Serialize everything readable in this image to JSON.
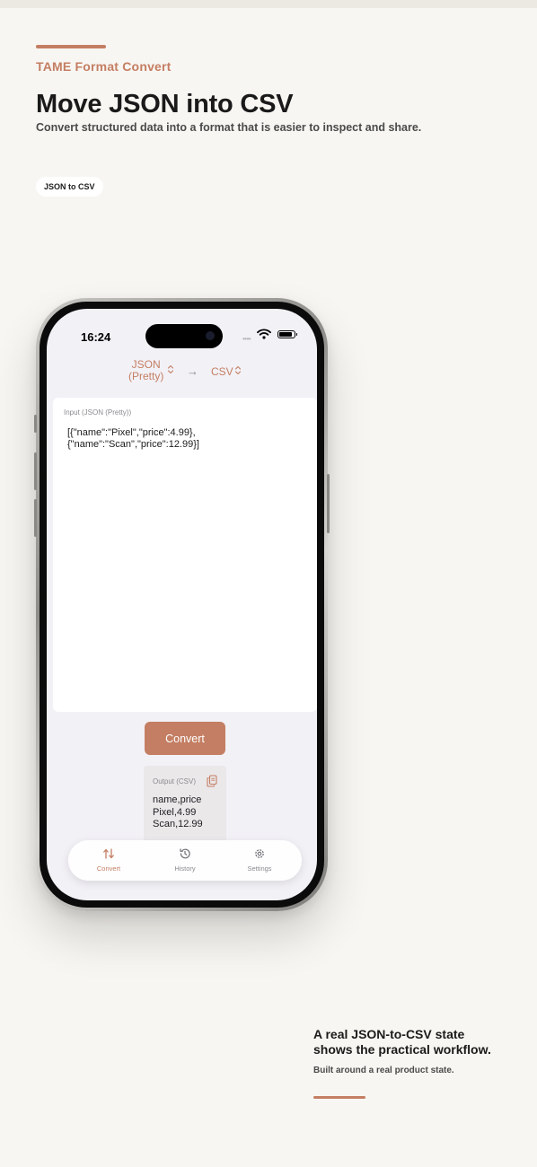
{
  "hero": {
    "brand": "TAME Format Convert",
    "headline": "Move JSON into CSV",
    "subhead": "Convert structured data into a format that is easier to inspect and share.",
    "pill": "JSON to CSV"
  },
  "device": {
    "status_time": "16:24",
    "signal_dots": "••••"
  },
  "app": {
    "from_format_line1": "JSON",
    "from_format_line2": "(Pretty)",
    "arrow": "→",
    "to_format": "CSV",
    "input_label": "Input (JSON (Pretty))",
    "input_value": "[{\"name\":\"Pixel\",\"price\":4.99},\n{\"name\":\"Scan\",\"price\":12.99}]",
    "convert_label": "Convert",
    "output_label": "Output (CSV)",
    "output_lines": [
      "name,price",
      "Pixel,4.99",
      "Scan,12.99"
    ],
    "tabs": [
      {
        "label": "Convert",
        "icon": "convert-icon",
        "active": true
      },
      {
        "label": "History",
        "icon": "history-icon",
        "active": false
      },
      {
        "label": "Settings",
        "icon": "gear-icon",
        "active": false
      }
    ]
  },
  "callout": {
    "title": "A real JSON-to-CSV state shows the practical workflow.",
    "subtitle": "Built around a real product state."
  },
  "colors": {
    "accent": "#c47e63",
    "background": "#f8f6f2",
    "screen": "#f2f1f6"
  }
}
